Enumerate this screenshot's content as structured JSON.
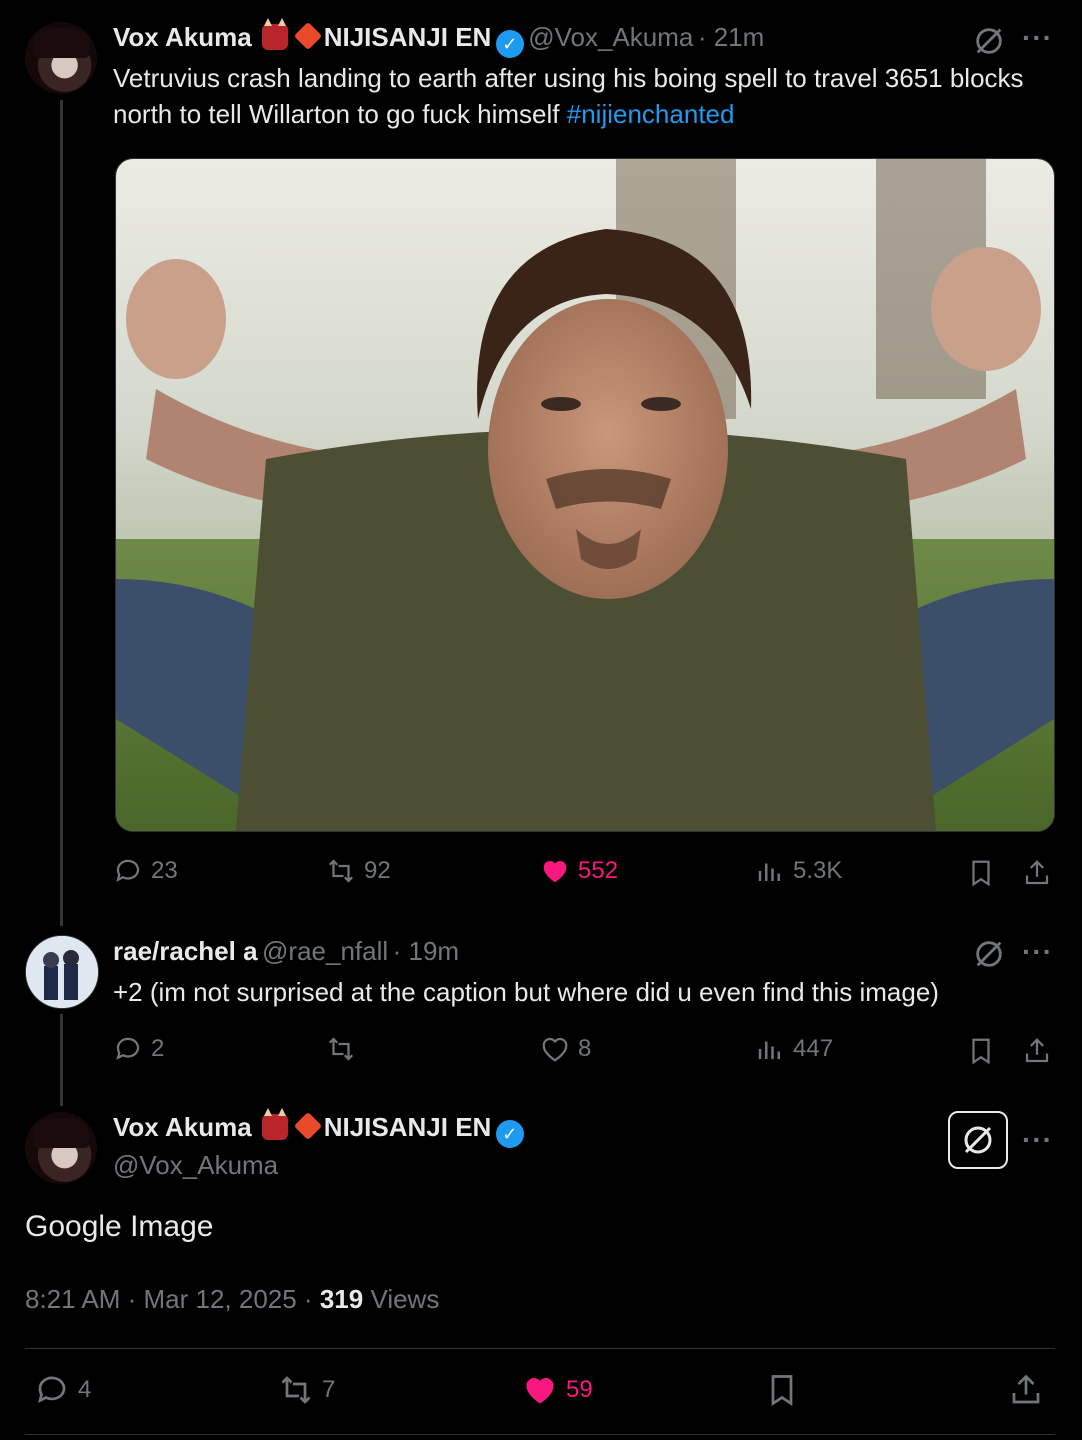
{
  "tweet1": {
    "name": "Vox Akuma",
    "affiliation": "NIJISANJI EN",
    "handle": "@Vox_Akuma",
    "time": "· 21m",
    "text": "Vetruvius crash landing to earth after using his boing spell to travel 3651 blocks north to tell Willarton to go fuck himself",
    "hashtag": "#nijienchanted",
    "replies": "23",
    "reposts": "92",
    "likes": "552",
    "views": "5.3K"
  },
  "reply": {
    "name": "rae/rachel a",
    "handle": "@rae_nfall",
    "time": "· 19m",
    "text": "+2 (im not surprised at the caption but where did u even find this image)",
    "replies": "2",
    "likes": "8",
    "views": "447"
  },
  "main": {
    "name": "Vox Akuma",
    "affiliation": "NIJISANJI EN",
    "handle": "@Vox_Akuma",
    "text": "Google Image",
    "timestamp": "8:21 AM · Mar 12, 2025 ·",
    "views_count": "319",
    "views_label": "Views",
    "replies": "4",
    "reposts": "7",
    "likes": "59"
  },
  "icons": {
    "verified": "verified-badge-icon",
    "reply": "reply-icon",
    "repost": "repost-icon",
    "like": "heart-icon",
    "views": "views-icon",
    "bookmark": "bookmark-icon",
    "share": "share-icon",
    "grok": "grok-icon",
    "more": "more-icon"
  },
  "colors": {
    "background": "#000000",
    "text": "#e7e9ea",
    "muted": "#71767b",
    "link": "#1d9bf0",
    "like": "#f91880"
  }
}
